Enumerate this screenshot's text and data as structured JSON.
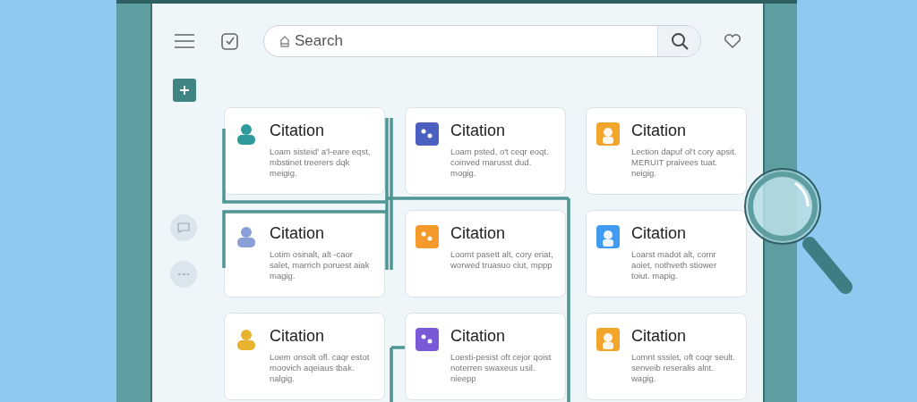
{
  "search": {
    "placeholder": "Search"
  },
  "cards": [
    {
      "title": "Citation",
      "body": "Loam sisteid' a'l-eare eqst, mbstinet treerers dqk meigig.",
      "color": "#2f9a9c"
    },
    {
      "title": "Citation",
      "body": "Loam psted, o't ceqr eoqt. coinved marusst dud. mogig.",
      "color": "#4a5fc0"
    },
    {
      "title": "Citation",
      "body": "Lection dapuf ol't cory apsit. MERUIT praivees tuat. neigig.",
      "color": "#f2a52a"
    },
    {
      "title": "Citation",
      "body": "Lotim osinalt, alt -caor salet, marrich poruest aiak magig.",
      "color": "#8a9fd8"
    },
    {
      "title": "Citation",
      "body": "Loomt pasett alt, cory eriat, worwed truasuo ciut, mppp",
      "color": "#f39a2a"
    },
    {
      "title": "Citation",
      "body": "Loarst madot alt, comr aoiet, nothveth stiower toiut. mapig.",
      "color": "#3f9bf0"
    },
    {
      "title": "Citation",
      "body": "Loem onsolt ofl. caqr estot moovich aqeiaus tbak. nalgig.",
      "color": "#e8b430"
    },
    {
      "title": "Citation",
      "body": "Loesti-pesist oft cejor qoist noterren swaxeus usil. nieepp",
      "color": "#7b58d6"
    },
    {
      "title": "Citation",
      "body": "Lomnt sssiet, oft coqr seult. senveib reseralis alnt. wagig.",
      "color": "#f2a52a"
    }
  ]
}
